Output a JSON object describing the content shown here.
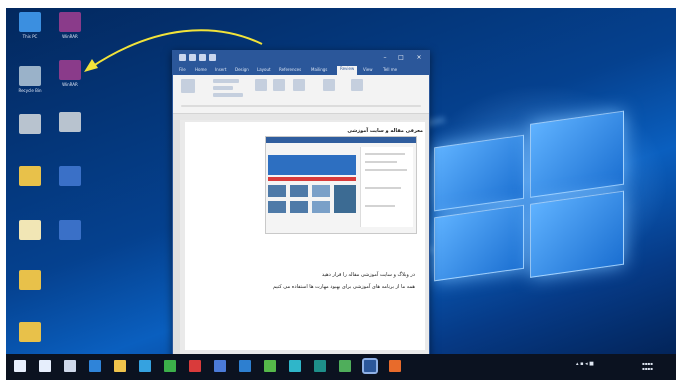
{
  "desktop_icons": [
    {
      "name": "this-pc",
      "label": "This PC",
      "color": "#3b8fe0"
    },
    {
      "name": "winrar-top",
      "label": "WinRAR",
      "color": "#8a3b8a"
    },
    {
      "name": "recycle-bin",
      "label": "Recycle Bin",
      "color": "#9ab2c9"
    },
    {
      "name": "winrar-2",
      "label": "WinRAR",
      "color": "#8a3b8a"
    },
    {
      "name": "shortcut-3",
      "label": "",
      "color": "#b8c3cf"
    },
    {
      "name": "shortcut-4",
      "label": "",
      "color": "#b8c3cf"
    },
    {
      "name": "folder-1",
      "label": "",
      "color": "#e8c14a"
    },
    {
      "name": "word-doc-1",
      "label": "",
      "color": "#3a70c7"
    },
    {
      "name": "document-1",
      "label": "",
      "color": "#f1e6b5"
    },
    {
      "name": "word-doc-2",
      "label": "",
      "color": "#3a70c7"
    },
    {
      "name": "archive-1",
      "label": "",
      "color": "#e8c14a"
    },
    {
      "name": "folder-2",
      "label": "",
      "color": "#e8c14a"
    }
  ],
  "word_window": {
    "tabs": [
      "File",
      "Home",
      "Insert",
      "Design",
      "Layout",
      "References",
      "Mailings",
      "Review",
      "View",
      "Tell me"
    ],
    "document": {
      "heading": "معرفی مقاله و سایت آموزشی",
      "paragraph1": "در وبلاگ و سایت آموزشی مقاله را قرار دهید",
      "paragraph2": "همه ما از برنامه های آموزشی برای بهبود مهارت ها استفاده می کنیم"
    }
  },
  "taskbar": {
    "apps": [
      "start",
      "search",
      "task-view",
      "edge",
      "explorer",
      "store",
      "chrome",
      "app-red",
      "app-blue",
      "mail",
      "app-green",
      "app-cyan",
      "app-teal",
      "app-green2",
      "word",
      "app-orange"
    ],
    "colors": {
      "start": "#e6eefc",
      "search": "#e6eefc",
      "task-view": "#cfd9ea",
      "edge": "#2f84d9",
      "explorer": "#f0c44c",
      "store": "#35a2e0",
      "chrome": "#3cb04a",
      "app-red": "#d93b3b",
      "app-blue": "#4b7bd8",
      "mail": "#2d7fd0",
      "app-green": "#56b84a",
      "app-cyan": "#2fb6c9",
      "app-teal": "#1e8f8a",
      "app-green2": "#4fae5b",
      "word": "#2b579a",
      "app-orange": "#e86b2b"
    }
  }
}
